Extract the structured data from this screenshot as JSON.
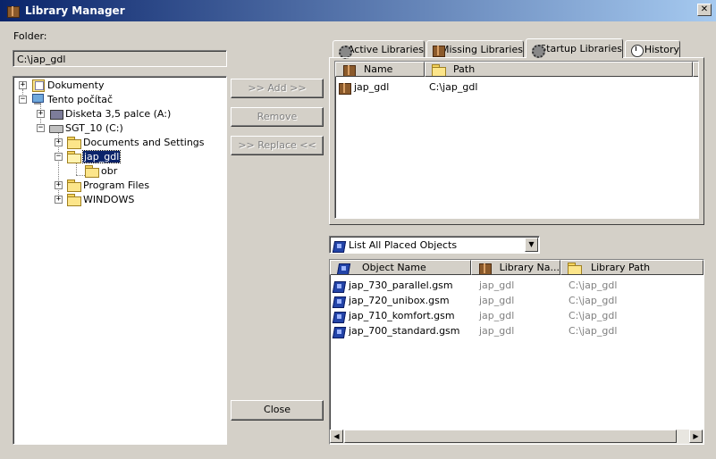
{
  "window": {
    "title": "Library Manager",
    "close_glyph": "✕"
  },
  "folder": {
    "label": "Folder:",
    "value": "C:\\jap_gdl"
  },
  "tree": [
    {
      "label": "Dokumenty",
      "expander": "+"
    },
    {
      "label": "Tento počítač",
      "expander": "−"
    },
    {
      "label": "Disketa 3,5 palce (A:)",
      "expander": "+"
    },
    {
      "label": "SGT_10 (C:)",
      "expander": "−"
    },
    {
      "label": "Documents and Settings",
      "expander": "+"
    },
    {
      "label": "jap_gdl",
      "expander": "−"
    },
    {
      "label": "obr"
    },
    {
      "label": "Program Files",
      "expander": "+"
    },
    {
      "label": "WINDOWS",
      "expander": "+"
    }
  ],
  "buttons": {
    "add": ">> Add >>",
    "remove": "Remove",
    "replace": ">> Replace <<",
    "close": "Close"
  },
  "tabs": [
    "Active Libraries",
    "Missing Libraries",
    "Startup Libraries",
    "History"
  ],
  "libraries": {
    "headers": [
      "Name",
      "Path"
    ],
    "rows": [
      {
        "name": "jap_gdl",
        "path": "C:\\jap_gdl"
      }
    ]
  },
  "filter": {
    "selected": "List All Placed Objects"
  },
  "objects": {
    "headers": [
      "Object Name",
      "Library Na...",
      "Library Path"
    ],
    "rows": [
      {
        "name": "jap_730_parallel.gsm",
        "lib": "jap_gdl",
        "path": "C:\\jap_gdl"
      },
      {
        "name": "jap_720_unibox.gsm",
        "lib": "jap_gdl",
        "path": "C:\\jap_gdl"
      },
      {
        "name": "jap_710_komfort.gsm",
        "lib": "jap_gdl",
        "path": "C:\\jap_gdl"
      },
      {
        "name": "jap_700_standard.gsm",
        "lib": "jap_gdl",
        "path": "C:\\jap_gdl"
      }
    ]
  },
  "scroll": {
    "left": "◀",
    "right": "▶",
    "down": "▼"
  }
}
